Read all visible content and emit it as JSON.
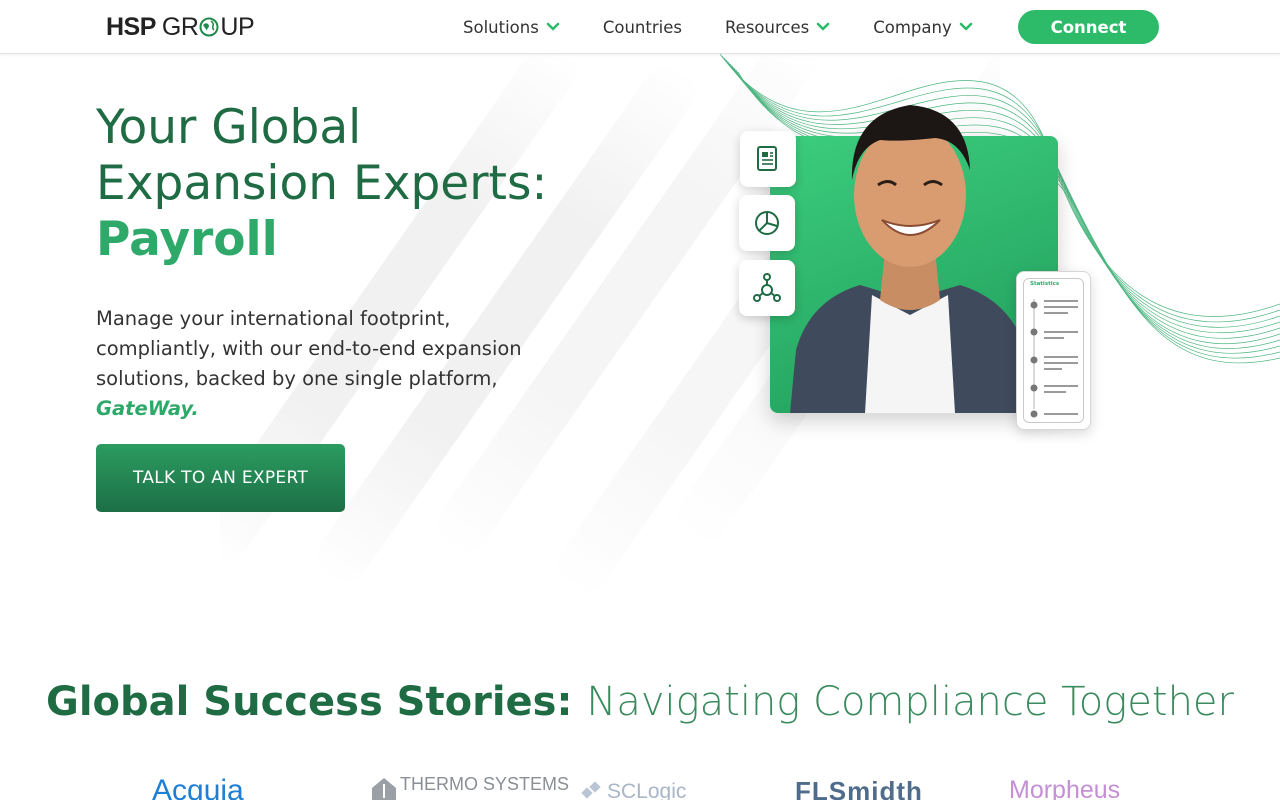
{
  "header": {
    "logo_text_1": "HSP",
    "logo_text_2": "GR",
    "logo_text_3": "UP",
    "nav": [
      {
        "label": "Solutions",
        "has_dropdown": true
      },
      {
        "label": "Countries",
        "has_dropdown": false
      },
      {
        "label": "Resources",
        "has_dropdown": true
      },
      {
        "label": "Company",
        "has_dropdown": true
      }
    ],
    "connect_label": "Connect"
  },
  "hero": {
    "title_line_1": "Your Global",
    "title_line_2": "Expansion Experts:",
    "title_accent": "Payroll",
    "description": "Manage your international footprint, compliantly, with our end-to-end expansion solutions, backed by one single platform,",
    "brand": "GateWay.",
    "cta_label": "TALK TO AN EXPERT",
    "stats_label": "Statistics"
  },
  "stories": {
    "title_strong": "Global Success Stories:",
    "title_light": "Navigating Compliance Together"
  },
  "clients": [
    {
      "name": "Acquia",
      "color": "#1d7fd6"
    },
    {
      "name": "THERMO SYSTEMS",
      "color": "#8a8f96"
    },
    {
      "name": "SCLogic",
      "color": "#a9b6c8"
    },
    {
      "name": "FLSmidth",
      "color": "#4f6c8a"
    },
    {
      "name": "Morpheus",
      "color": "#c58fd6"
    }
  ],
  "colors": {
    "brand_green": "#2ea96a",
    "dark_green": "#1f6b44",
    "connect_green": "#2dbb6a"
  }
}
